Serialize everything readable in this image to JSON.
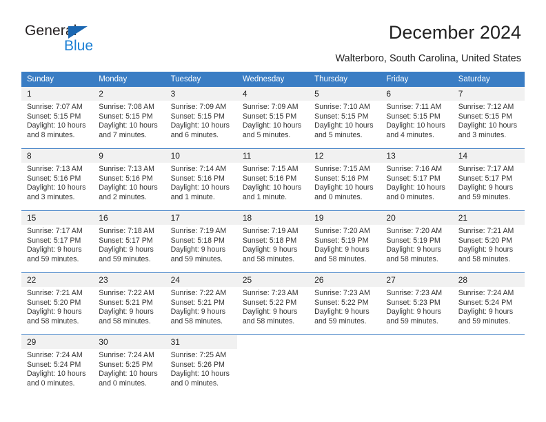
{
  "logo": {
    "word1": "General",
    "word2": "Blue",
    "triangle_color": "#1b67b2",
    "blue_color": "#1b7fd4"
  },
  "header": {
    "title": "December 2024",
    "subtitle": "Walterboro, South Carolina, United States"
  },
  "theme": {
    "header_blue": "#3a7dc4",
    "grid_line": "#4a86c8",
    "daynum_bg": "#f1f1f1"
  },
  "weekdays": [
    "Sunday",
    "Monday",
    "Tuesday",
    "Wednesday",
    "Thursday",
    "Friday",
    "Saturday"
  ],
  "labels": {
    "sunrise_prefix": "Sunrise: ",
    "sunset_prefix": "Sunset: ",
    "daylight_prefix": "Daylight: "
  },
  "weeks": [
    [
      {
        "day": "1",
        "sunrise": "Sunrise: 7:07 AM",
        "sunset": "Sunset: 5:15 PM",
        "daylight1": "Daylight: 10 hours",
        "daylight2": "and 8 minutes."
      },
      {
        "day": "2",
        "sunrise": "Sunrise: 7:08 AM",
        "sunset": "Sunset: 5:15 PM",
        "daylight1": "Daylight: 10 hours",
        "daylight2": "and 7 minutes."
      },
      {
        "day": "3",
        "sunrise": "Sunrise: 7:09 AM",
        "sunset": "Sunset: 5:15 PM",
        "daylight1": "Daylight: 10 hours",
        "daylight2": "and 6 minutes."
      },
      {
        "day": "4",
        "sunrise": "Sunrise: 7:09 AM",
        "sunset": "Sunset: 5:15 PM",
        "daylight1": "Daylight: 10 hours",
        "daylight2": "and 5 minutes."
      },
      {
        "day": "5",
        "sunrise": "Sunrise: 7:10 AM",
        "sunset": "Sunset: 5:15 PM",
        "daylight1": "Daylight: 10 hours",
        "daylight2": "and 5 minutes."
      },
      {
        "day": "6",
        "sunrise": "Sunrise: 7:11 AM",
        "sunset": "Sunset: 5:15 PM",
        "daylight1": "Daylight: 10 hours",
        "daylight2": "and 4 minutes."
      },
      {
        "day": "7",
        "sunrise": "Sunrise: 7:12 AM",
        "sunset": "Sunset: 5:15 PM",
        "daylight1": "Daylight: 10 hours",
        "daylight2": "and 3 minutes."
      }
    ],
    [
      {
        "day": "8",
        "sunrise": "Sunrise: 7:13 AM",
        "sunset": "Sunset: 5:16 PM",
        "daylight1": "Daylight: 10 hours",
        "daylight2": "and 3 minutes."
      },
      {
        "day": "9",
        "sunrise": "Sunrise: 7:13 AM",
        "sunset": "Sunset: 5:16 PM",
        "daylight1": "Daylight: 10 hours",
        "daylight2": "and 2 minutes."
      },
      {
        "day": "10",
        "sunrise": "Sunrise: 7:14 AM",
        "sunset": "Sunset: 5:16 PM",
        "daylight1": "Daylight: 10 hours",
        "daylight2": "and 1 minute."
      },
      {
        "day": "11",
        "sunrise": "Sunrise: 7:15 AM",
        "sunset": "Sunset: 5:16 PM",
        "daylight1": "Daylight: 10 hours",
        "daylight2": "and 1 minute."
      },
      {
        "day": "12",
        "sunrise": "Sunrise: 7:15 AM",
        "sunset": "Sunset: 5:16 PM",
        "daylight1": "Daylight: 10 hours",
        "daylight2": "and 0 minutes."
      },
      {
        "day": "13",
        "sunrise": "Sunrise: 7:16 AM",
        "sunset": "Sunset: 5:17 PM",
        "daylight1": "Daylight: 10 hours",
        "daylight2": "and 0 minutes."
      },
      {
        "day": "14",
        "sunrise": "Sunrise: 7:17 AM",
        "sunset": "Sunset: 5:17 PM",
        "daylight1": "Daylight: 9 hours",
        "daylight2": "and 59 minutes."
      }
    ],
    [
      {
        "day": "15",
        "sunrise": "Sunrise: 7:17 AM",
        "sunset": "Sunset: 5:17 PM",
        "daylight1": "Daylight: 9 hours",
        "daylight2": "and 59 minutes."
      },
      {
        "day": "16",
        "sunrise": "Sunrise: 7:18 AM",
        "sunset": "Sunset: 5:17 PM",
        "daylight1": "Daylight: 9 hours",
        "daylight2": "and 59 minutes."
      },
      {
        "day": "17",
        "sunrise": "Sunrise: 7:19 AM",
        "sunset": "Sunset: 5:18 PM",
        "daylight1": "Daylight: 9 hours",
        "daylight2": "and 59 minutes."
      },
      {
        "day": "18",
        "sunrise": "Sunrise: 7:19 AM",
        "sunset": "Sunset: 5:18 PM",
        "daylight1": "Daylight: 9 hours",
        "daylight2": "and 58 minutes."
      },
      {
        "day": "19",
        "sunrise": "Sunrise: 7:20 AM",
        "sunset": "Sunset: 5:19 PM",
        "daylight1": "Daylight: 9 hours",
        "daylight2": "and 58 minutes."
      },
      {
        "day": "20",
        "sunrise": "Sunrise: 7:20 AM",
        "sunset": "Sunset: 5:19 PM",
        "daylight1": "Daylight: 9 hours",
        "daylight2": "and 58 minutes."
      },
      {
        "day": "21",
        "sunrise": "Sunrise: 7:21 AM",
        "sunset": "Sunset: 5:20 PM",
        "daylight1": "Daylight: 9 hours",
        "daylight2": "and 58 minutes."
      }
    ],
    [
      {
        "day": "22",
        "sunrise": "Sunrise: 7:21 AM",
        "sunset": "Sunset: 5:20 PM",
        "daylight1": "Daylight: 9 hours",
        "daylight2": "and 58 minutes."
      },
      {
        "day": "23",
        "sunrise": "Sunrise: 7:22 AM",
        "sunset": "Sunset: 5:21 PM",
        "daylight1": "Daylight: 9 hours",
        "daylight2": "and 58 minutes."
      },
      {
        "day": "24",
        "sunrise": "Sunrise: 7:22 AM",
        "sunset": "Sunset: 5:21 PM",
        "daylight1": "Daylight: 9 hours",
        "daylight2": "and 58 minutes."
      },
      {
        "day": "25",
        "sunrise": "Sunrise: 7:23 AM",
        "sunset": "Sunset: 5:22 PM",
        "daylight1": "Daylight: 9 hours",
        "daylight2": "and 58 minutes."
      },
      {
        "day": "26",
        "sunrise": "Sunrise: 7:23 AM",
        "sunset": "Sunset: 5:22 PM",
        "daylight1": "Daylight: 9 hours",
        "daylight2": "and 59 minutes."
      },
      {
        "day": "27",
        "sunrise": "Sunrise: 7:23 AM",
        "sunset": "Sunset: 5:23 PM",
        "daylight1": "Daylight: 9 hours",
        "daylight2": "and 59 minutes."
      },
      {
        "day": "28",
        "sunrise": "Sunrise: 7:24 AM",
        "sunset": "Sunset: 5:24 PM",
        "daylight1": "Daylight: 9 hours",
        "daylight2": "and 59 minutes."
      }
    ],
    [
      {
        "day": "29",
        "sunrise": "Sunrise: 7:24 AM",
        "sunset": "Sunset: 5:24 PM",
        "daylight1": "Daylight: 10 hours",
        "daylight2": "and 0 minutes."
      },
      {
        "day": "30",
        "sunrise": "Sunrise: 7:24 AM",
        "sunset": "Sunset: 5:25 PM",
        "daylight1": "Daylight: 10 hours",
        "daylight2": "and 0 minutes."
      },
      {
        "day": "31",
        "sunrise": "Sunrise: 7:25 AM",
        "sunset": "Sunset: 5:26 PM",
        "daylight1": "Daylight: 10 hours",
        "daylight2": "and 0 minutes."
      },
      {
        "day": "",
        "sunrise": "",
        "sunset": "",
        "daylight1": "",
        "daylight2": ""
      },
      {
        "day": "",
        "sunrise": "",
        "sunset": "",
        "daylight1": "",
        "daylight2": ""
      },
      {
        "day": "",
        "sunrise": "",
        "sunset": "",
        "daylight1": "",
        "daylight2": ""
      },
      {
        "day": "",
        "sunrise": "",
        "sunset": "",
        "daylight1": "",
        "daylight2": ""
      }
    ]
  ]
}
